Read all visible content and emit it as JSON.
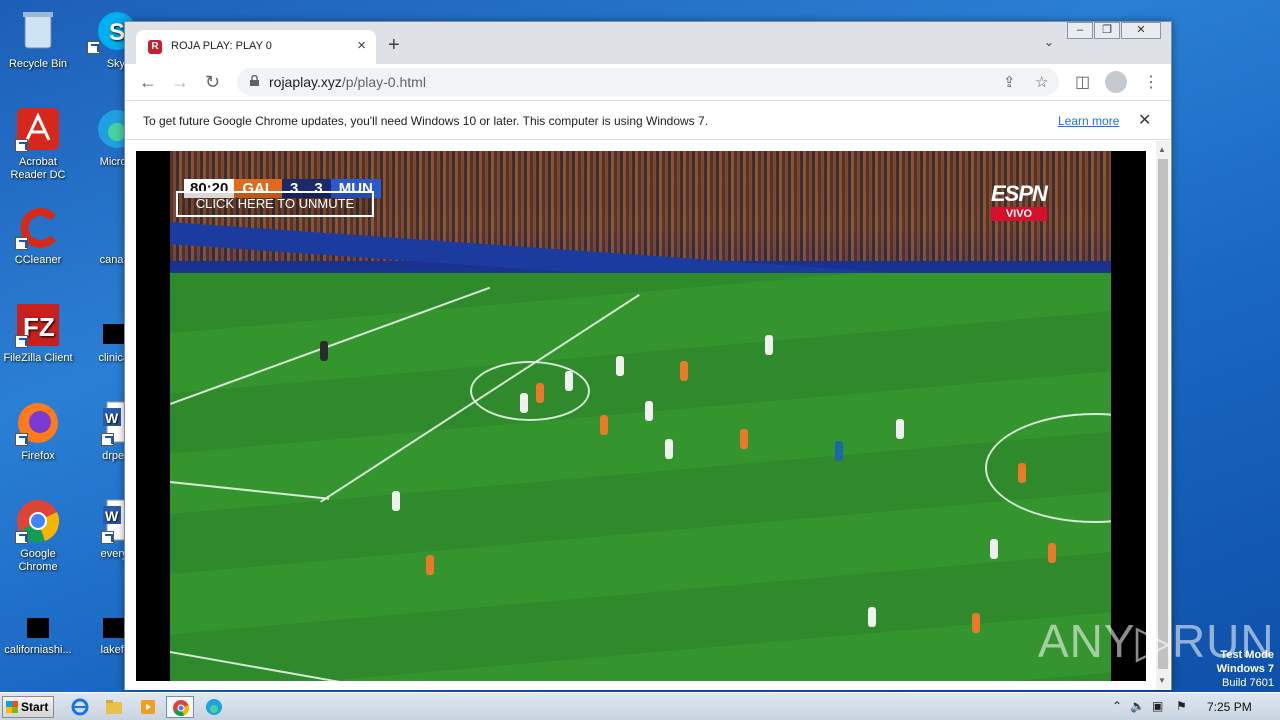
{
  "desktop": {
    "icons_col1": [
      {
        "label": "Recycle Bin",
        "icon": "recycle-bin-icon"
      },
      {
        "label": "Acrobat Reader DC",
        "icon": "acrobat-icon"
      },
      {
        "label": "CCleaner",
        "icon": "ccleaner-icon"
      },
      {
        "label": "FileZilla Client",
        "icon": "filezilla-icon"
      },
      {
        "label": "Firefox",
        "icon": "firefox-icon"
      },
      {
        "label": "Google Chrome",
        "icon": "chrome-icon"
      },
      {
        "label": "californiashi...",
        "icon": "file-icon"
      }
    ],
    "icons_col2": [
      {
        "label": "Skype",
        "icon": "skype-icon"
      },
      {
        "label": "Microsoft",
        "icon": "edge-icon"
      },
      {
        "label": "canadian",
        "icon": "file-icon"
      },
      {
        "label": "clinicaljac",
        "icon": "file-icon"
      },
      {
        "label": "drpeace",
        "icon": "word-icon"
      },
      {
        "label": "everypre",
        "icon": "word-icon"
      },
      {
        "label": "lakefinall",
        "icon": "file-icon"
      }
    ]
  },
  "browser": {
    "tab_title": "ROJA PLAY: PLAY 0",
    "tab_favicon_letter": "R",
    "url_host": "rojaplay.xyz",
    "url_path": "/p/play-0.html",
    "infobar_text": "To get future Google Chrome updates, you'll need Windows 10 or later. This computer is using Windows 7.",
    "infobar_link": "Learn more"
  },
  "video": {
    "time": "80:20",
    "home": "GAL",
    "home_score": "3",
    "away_score": "3",
    "away": "MUN",
    "unmute_label": "CLICK HERE TO UNMUTE",
    "broadcaster": "ESPN",
    "live_badge": "VIVO"
  },
  "overlay": {
    "watermark": "ANY▷RUN",
    "test_mode": "Test Mode",
    "os": "Windows 7",
    "build": "Build 7601"
  },
  "taskbar": {
    "start_label": "Start",
    "clock": "7:25 PM"
  },
  "colors": {
    "desktop": "#1d6ac4",
    "accent_link": "#1a73e8",
    "home_team": "#e06a1a",
    "away_team": "#2a5ad0",
    "live": "#d4102a"
  }
}
